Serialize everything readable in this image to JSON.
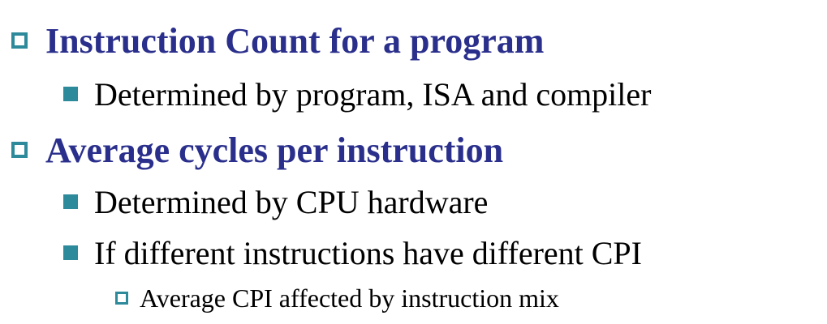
{
  "slide": {
    "items": [
      {
        "level": 1,
        "text": "Instruction Count for a program"
      },
      {
        "level": 2,
        "text": "Determined by program, ISA and compiler"
      },
      {
        "level": 1,
        "text": "Average cycles per instruction"
      },
      {
        "level": 2,
        "text": "Determined by CPU hardware"
      },
      {
        "level": 2,
        "text": "If different instructions have different CPI"
      },
      {
        "level": 3,
        "text": "Average CPI affected by instruction mix"
      }
    ]
  },
  "colors": {
    "heading": "#2a2f8c",
    "bullet": "#2d8a9b",
    "body_text": "#000000"
  }
}
